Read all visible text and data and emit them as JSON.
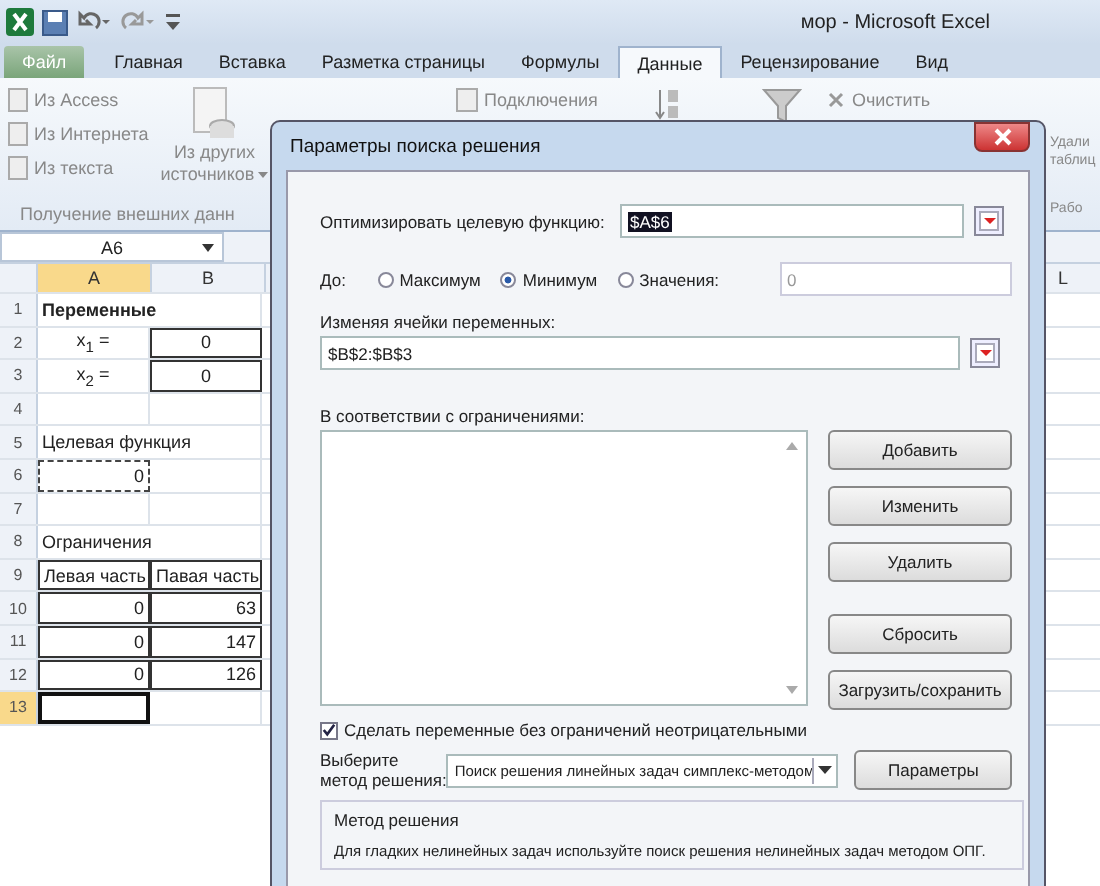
{
  "window": {
    "title": "мор  -  Microsoft Excel"
  },
  "ribbon_tabs": [
    {
      "label": "Файл",
      "kind": "file",
      "selected": false
    },
    {
      "label": "Главная",
      "kind": "tab",
      "selected": false
    },
    {
      "label": "Вставка",
      "kind": "tab",
      "selected": false
    },
    {
      "label": "Разметка страницы",
      "kind": "tab",
      "selected": false
    },
    {
      "label": "Формулы",
      "kind": "tab",
      "selected": false
    },
    {
      "label": "Данные",
      "kind": "tab",
      "selected": true
    },
    {
      "label": "Рецензирование",
      "kind": "tab",
      "selected": false
    },
    {
      "label": "Вид",
      "kind": "tab",
      "selected": false
    }
  ],
  "ribbon": {
    "import_items": [
      "Из Access",
      "Из Интернета",
      "Из текста"
    ],
    "other_sources": [
      "Из других",
      "источников"
    ],
    "group_label": "Получение внешних данн",
    "connections": "Подключения",
    "clear": "Очистить",
    "remove": [
      "Удали",
      "таблиц"
    ],
    "work_group": "Рабо"
  },
  "name_box": "A6",
  "sheet": {
    "columns": [
      "A",
      "B",
      "L"
    ],
    "rows": [
      {
        "number": "1",
        "selected": false,
        "cells": [
          "Переменные"
        ]
      },
      {
        "number": "2",
        "selected": false,
        "cells": [
          "x$_{1}$ =",
          "0"
        ]
      },
      {
        "number": "3",
        "selected": false,
        "cells": [
          "x$_{2}$ =",
          "0"
        ]
      },
      {
        "number": "4",
        "selected": false
      },
      {
        "number": "5",
        "selected": false,
        "cells": [
          "Целевая функция"
        ]
      },
      {
        "number": "6",
        "selected": false,
        "cells": [
          "0"
        ]
      },
      {
        "number": "7",
        "selected": false
      },
      {
        "number": "8",
        "selected": false,
        "cells": [
          "Ограничения"
        ]
      },
      {
        "number": "9",
        "selected": false,
        "cells": [
          "Левая часть",
          "Павая часть"
        ]
      },
      {
        "number": "10",
        "selected": false,
        "cells": [
          "0",
          "63"
        ]
      },
      {
        "number": "11",
        "selected": false,
        "cells": [
          "0",
          "147"
        ]
      },
      {
        "number": "12",
        "selected": false,
        "cells": [
          "0",
          "126"
        ]
      },
      {
        "number": "13",
        "selected": true
      }
    ]
  },
  "dialog": {
    "title": "Параметры поиска решения",
    "objective_label": "Оптимизировать целевую функцию:",
    "objective_value": "$A$6",
    "to_label": "До:",
    "options": [
      {
        "label": "Максимум",
        "selected": false
      },
      {
        "label": "Минимум",
        "selected": true
      },
      {
        "label": "Значения:",
        "selected": false
      }
    ],
    "value_field": "0",
    "variables_label": "Изменяя ячейки переменных:",
    "variables_value": "$B$2:$B$3",
    "constraints_label": "В соответствии с ограничениями:",
    "buttons": [
      "Добавить",
      "Изменить",
      "Удалить",
      "Сбросить",
      "Загрузить/сохранить"
    ],
    "nonnegative": {
      "label": "Сделать переменные без ограничений неотрицательными",
      "checked": true
    },
    "method_label": [
      "Выберите",
      "метод решения:"
    ],
    "method_value": "Поиск решения линейных задач симплекс-методом",
    "options_button": "Параметры",
    "method_group": {
      "title": "Метод решения",
      "text": "Для гладких нелинейных задач используйте поиск решения нелинейных задач методом ОПГ."
    }
  }
}
